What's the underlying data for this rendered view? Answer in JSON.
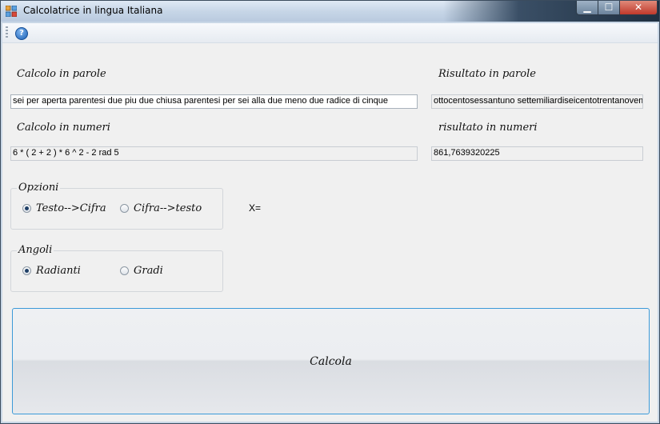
{
  "window": {
    "title": "Calcolatrice in lingua Italiana",
    "buttons": {
      "minimize": "▁",
      "maximize": "☐",
      "close": "✕"
    }
  },
  "toolbar": {
    "help_icon": "?"
  },
  "labels": {
    "calc_words": "Calcolo in parole",
    "result_words": "Risultato in parole",
    "calc_numbers": "Calcolo in numeri",
    "result_numbers": "risultato in numeri",
    "x_equals": "X="
  },
  "fields": {
    "calc_words_value": "sei per aperta parentesi due piu due chiusa parentesi per sei alla due meno due radice di cinque",
    "result_words_value": "ottocentosessantuno settemiliardiseicentotrentanovemil",
    "calc_numbers_value": "6 * ( 2 + 2 ) * 6 ^ 2 - 2 rad 5",
    "result_numbers_value": "861,7639320225"
  },
  "options": {
    "caption": "Opzioni",
    "text_to_digit": "Testo-->Cifra",
    "digit_to_text": "Cifra-->testo",
    "selected": "text_to_digit"
  },
  "angles": {
    "caption": "Angoli",
    "radians": "Radianti",
    "degrees": "Gradi",
    "selected": "radians"
  },
  "action": {
    "calculate": "Calcola"
  }
}
